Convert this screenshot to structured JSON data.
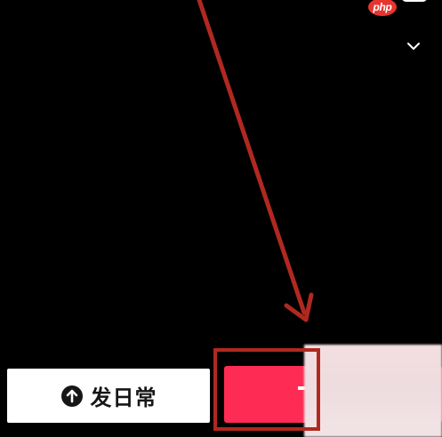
{
  "badge": {
    "text": "php"
  },
  "icons": {
    "top_right": "collapse-chevron-icon",
    "upload": "upload-arrow-icon",
    "annotation": "red-arrow-icon"
  },
  "bottom_bar": {
    "daily_label": "发日常",
    "shoot_label": ""
  },
  "colors": {
    "background": "#000000",
    "primary_button": "#fe2c55",
    "secondary_button": "#ffffff",
    "annotation": "#b0291f"
  }
}
